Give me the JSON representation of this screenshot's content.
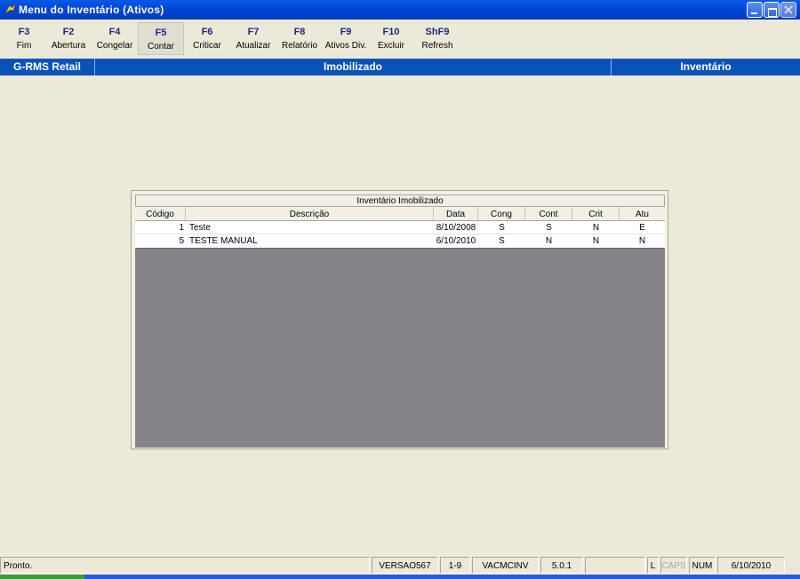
{
  "window": {
    "title": "Menu do Inventário (Ativos)"
  },
  "toolbar": [
    {
      "key": "F3",
      "label": "Fim",
      "active": false
    },
    {
      "key": "F2",
      "label": "Abertura",
      "active": false
    },
    {
      "key": "F4",
      "label": "Congelar",
      "active": false
    },
    {
      "key": "F5",
      "label": "Contar",
      "active": true
    },
    {
      "key": "F6",
      "label": "Criticar",
      "active": false
    },
    {
      "key": "F7",
      "label": "Atualizar",
      "active": false
    },
    {
      "key": "F8",
      "label": "Relatório",
      "active": false
    },
    {
      "key": "F9",
      "label": "Ativos Div.",
      "active": false
    },
    {
      "key": "F10",
      "label": "Excluir",
      "active": false
    },
    {
      "key": "ShF9",
      "label": "Refresh",
      "active": false
    }
  ],
  "header": {
    "left": "G-RMS Retail",
    "center": "Imobilizado",
    "right": "Inventário"
  },
  "grid": {
    "title": "Inventário Imobilizado",
    "columns": [
      "Código",
      "Descrição",
      "Data",
      "Cong",
      "Cont",
      "Crit",
      "Atu"
    ],
    "rows": [
      [
        "1",
        "Teste",
        "8/10/2008",
        "S",
        "S",
        "N",
        "E"
      ],
      [
        "5",
        "TESTE MANUAL",
        "6/10/2010",
        "S",
        "N",
        "N",
        "N"
      ]
    ]
  },
  "status": {
    "message": "Pronto.",
    "version": "VERSAO567",
    "range": "1-9",
    "module": "VACMCINV",
    "release": "5.0.1",
    "empty": "",
    "l": "L",
    "caps": "CAPS",
    "num": "NUM",
    "date": "6/10/2010"
  },
  "colors": {
    "title_bar": "#0047d6",
    "header_bar": "#0b52b8",
    "toolbar_key": "#1c2a82",
    "grid_empty": "#86848a"
  }
}
